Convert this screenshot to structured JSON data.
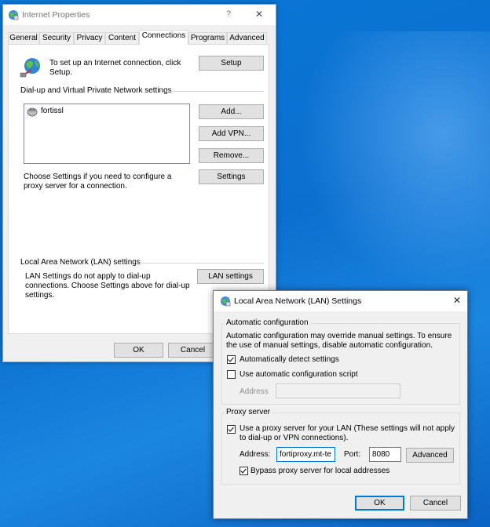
{
  "internet_properties": {
    "title": "Internet Properties",
    "help_glyph": "?",
    "close_glyph": "✕",
    "tabs": [
      {
        "label": "General"
      },
      {
        "label": "Security"
      },
      {
        "label": "Privacy"
      },
      {
        "label": "Content"
      },
      {
        "label": "Connections"
      },
      {
        "label": "Programs"
      },
      {
        "label": "Advanced"
      }
    ],
    "active_tab": "Connections",
    "setup_text": "To set up an Internet connection, click Setup.",
    "setup_button": "Setup",
    "dialup_section_label": "Dial-up and Virtual Private Network settings",
    "connections_list": [
      {
        "name": "fortissl"
      }
    ],
    "add_button": "Add...",
    "add_vpn_button": "Add VPN...",
    "remove_button": "Remove...",
    "settings_text": "Choose Settings if you need to configure a proxy server for a connection.",
    "settings_button": "Settings",
    "lan_section_label": "Local Area Network (LAN) settings",
    "lan_text": "LAN Settings do not apply to dial-up connections. Choose Settings above for dial-up settings.",
    "lan_settings_button": "LAN settings",
    "ok_button": "OK",
    "cancel_button": "Cancel"
  },
  "lan_settings": {
    "title": "Local Area Network (LAN) Settings",
    "close_glyph": "✕",
    "auto_config_group": "Automatic configuration",
    "auto_config_text": "Automatic configuration may override manual settings.  To ensure the use of manual settings, disable automatic configuration.",
    "auto_detect_label": "Automatically detect settings",
    "auto_detect_checked": true,
    "auto_script_label": "Use automatic configuration script",
    "auto_script_checked": false,
    "script_address_label": "Address",
    "script_address_value": "",
    "proxy_group": "Proxy server",
    "use_proxy_label": "Use a proxy server for your LAN (These settings will not apply to dial-up or VPN connections).",
    "use_proxy_checked": true,
    "address_label": "Address:",
    "address_value": "fortiproxy.mt-te",
    "port_label": "Port:",
    "port_value": "8080",
    "advanced_button": "Advanced",
    "bypass_label": "Bypass proxy server for local addresses",
    "bypass_checked": true,
    "ok_button": "OK",
    "cancel_button": "Cancel"
  }
}
